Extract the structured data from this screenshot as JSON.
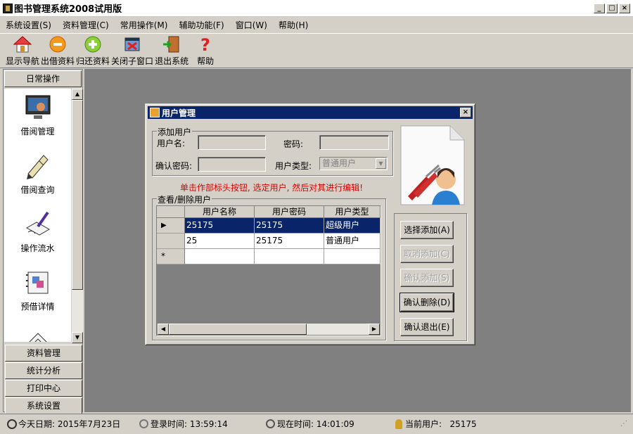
{
  "window": {
    "title": "图书管理系统2008试用版"
  },
  "menu": [
    "系统设置(S)",
    "资料管理(C)",
    "常用操作(M)",
    "辅助功能(F)",
    "窗口(W)",
    "帮助(H)"
  ],
  "toolbar": [
    {
      "label": "显示导航",
      "icon": "home-icon"
    },
    {
      "label": "出借资料",
      "icon": "minus-circle-icon"
    },
    {
      "label": "归还资料",
      "icon": "plus-circle-icon"
    },
    {
      "label": "关闭子窗口",
      "icon": "close-window-icon"
    },
    {
      "label": "退出系统",
      "icon": "exit-door-icon"
    },
    {
      "label": "帮助",
      "icon": "help-icon"
    }
  ],
  "sidebar": {
    "active_group": "日常操作",
    "items": [
      {
        "label": "借阅管理",
        "icon": "borrow-manage-icon"
      },
      {
        "label": "借阅查询",
        "icon": "borrow-query-icon"
      },
      {
        "label": "操作流水",
        "icon": "operation-log-icon"
      },
      {
        "label": "预借详情",
        "icon": "reserve-detail-icon"
      }
    ],
    "groups": [
      "资料管理",
      "统计分析",
      "打印中心",
      "系统设置"
    ]
  },
  "dialog": {
    "title": "用户管理",
    "add_group": "添加用户",
    "username_label": "用户名:",
    "password_label": "密码:",
    "confirm_label": "确认密码:",
    "usertype_label": "用户类型:",
    "usertype_value": "普通用户",
    "hint": "单击作部标头按钮, 选定用户, 然后对其进行编辑!",
    "view_group": "查看/删除用户",
    "columns": [
      "用户名称",
      "用户密码",
      "用户类型"
    ],
    "rows": [
      {
        "name": "25175",
        "password": "25175",
        "type": "超级用户",
        "marker": "▶"
      },
      {
        "name": "25",
        "password": "25175",
        "type": "普通用户",
        "marker": ""
      }
    ],
    "new_row_marker": "*",
    "buttons": {
      "select_add": "选择添加(A)",
      "cancel_add": "取消添加(C)",
      "confirm_add": "确认添加(S)",
      "confirm_delete": "确认删除(D)",
      "confirm_exit": "确认退出(E)"
    }
  },
  "status": {
    "today": "今天日期: 2015年7月23日",
    "login": "登录时间: 13:59:14",
    "now": "现在时间: 14:01:09",
    "user": "当前用户:   25175"
  },
  "colors": {
    "selection": "#0a246a",
    "mdi_background": "#808080",
    "hint": "#e00000"
  }
}
